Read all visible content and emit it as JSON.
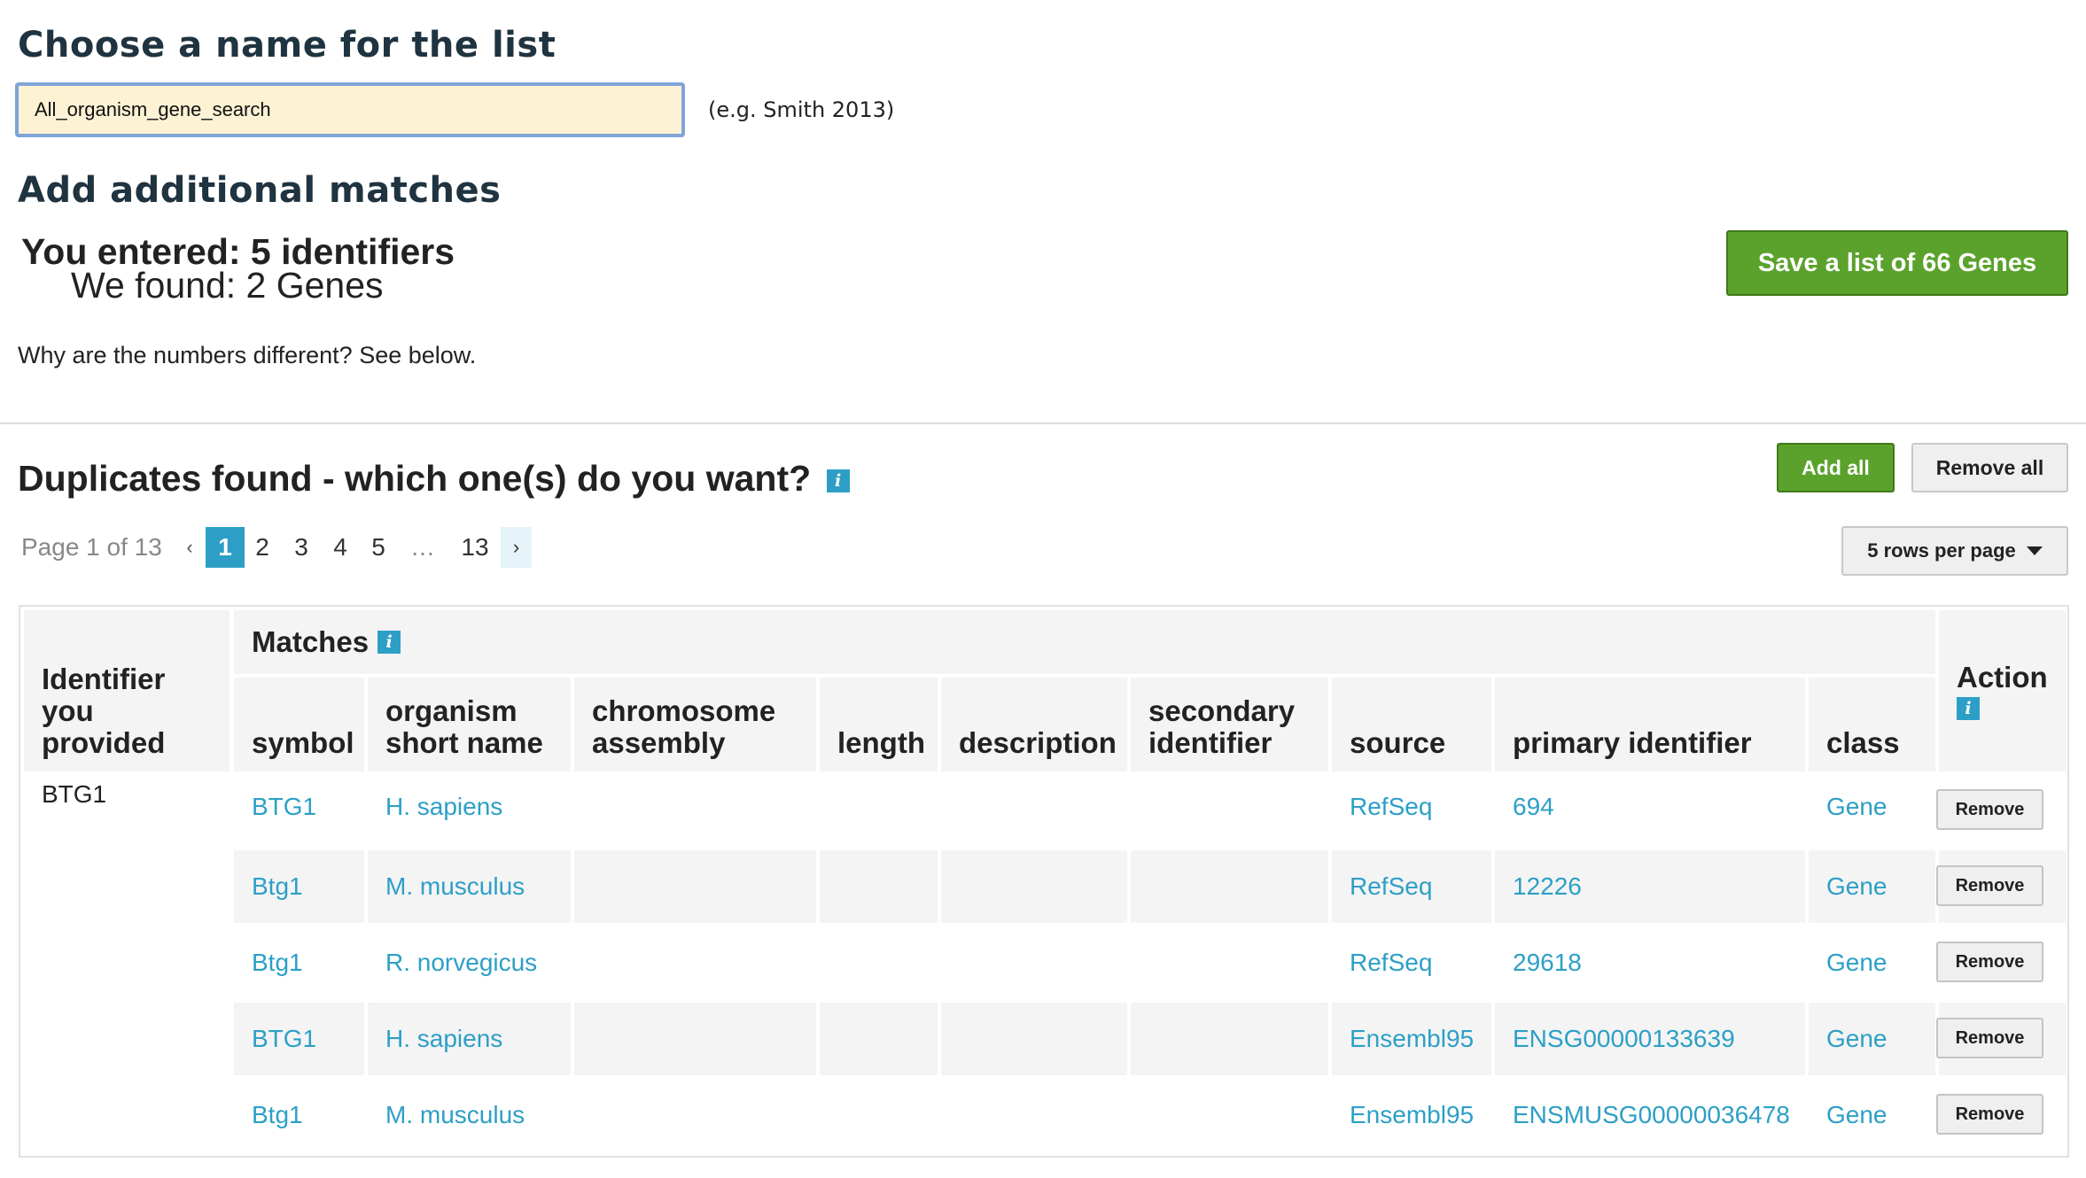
{
  "list_name": {
    "heading": "Choose a name for the list",
    "value": "All_organism_gene_search",
    "hint": "(e.g. Smith 2013)"
  },
  "summary": {
    "heading": "Add additional matches",
    "entered": "You entered: 5 identifiers",
    "found": "We found: 2 Genes",
    "why": "Why are the numbers different? See below.",
    "save_button": "Save a list of 66 Genes"
  },
  "duplicates": {
    "heading": "Duplicates found - which one(s) do you want?",
    "info_glyph": "i",
    "add_all": "Add all",
    "remove_all": "Remove all"
  },
  "pagination": {
    "status": "Page 1 of 13",
    "prev": "‹",
    "pages": [
      "1",
      "2",
      "3",
      "4",
      "5",
      "…",
      "13"
    ],
    "active_page": "1",
    "next": "›",
    "rows_per_page": "5 rows per page"
  },
  "table": {
    "col_identifier": "Identifier you provided",
    "group_matches": "Matches",
    "columns": {
      "symbol": "symbol",
      "organism": "organism short name",
      "chromosome": "chromosome assembly",
      "length": "length",
      "description": "description",
      "secondary": "secondary identifier",
      "source": "source",
      "primary": "primary identifier",
      "class": "class"
    },
    "col_action": "Action",
    "identifier": "BTG1",
    "rows": [
      {
        "symbol": "BTG1",
        "organism": "H. sapiens",
        "source": "RefSeq",
        "primary": "694",
        "class": "Gene",
        "action": "Remove"
      },
      {
        "symbol": "Btg1",
        "organism": "M. musculus",
        "source": "RefSeq",
        "primary": "12226",
        "class": "Gene",
        "action": "Remove"
      },
      {
        "symbol": "Btg1",
        "organism": "R. norvegicus",
        "source": "RefSeq",
        "primary": "29618",
        "class": "Gene",
        "action": "Remove"
      },
      {
        "symbol": "BTG1",
        "organism": "H. sapiens",
        "source": "Ensembl95",
        "primary": "ENSG00000133639",
        "class": "Gene",
        "action": "Remove"
      },
      {
        "symbol": "Btg1",
        "organism": "M. musculus",
        "source": "Ensembl95",
        "primary": "ENSMUSG00000036478",
        "class": "Gene",
        "action": "Remove"
      }
    ]
  },
  "colors": {
    "accent_blue": "#2d9fc7",
    "primary_green": "#5ba22c",
    "input_bg": "#fdf2d4",
    "heading_text": "#1f3340"
  }
}
